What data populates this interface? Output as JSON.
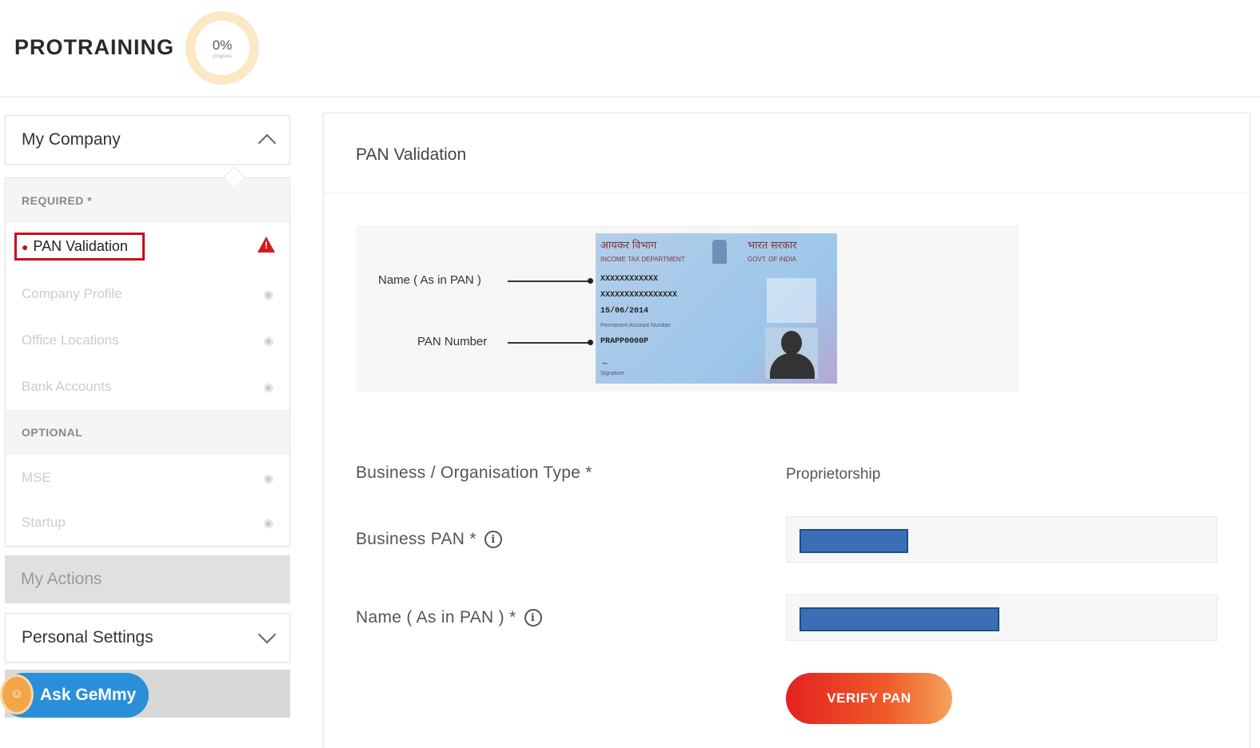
{
  "header": {
    "brand": "PROTRAINING",
    "progress_percent": "0%",
    "progress_caption": "progress",
    "progress_value": 0
  },
  "sidebar": {
    "my_company_label": "My Company",
    "required_label": "REQUIRED *",
    "optional_label": "OPTIONAL",
    "required_items": [
      {
        "label": "PAN Validation",
        "status": "alert"
      },
      {
        "label": "Company Profile",
        "status": "locked"
      },
      {
        "label": "Office Locations",
        "status": "locked"
      },
      {
        "label": "Bank Accounts",
        "status": "locked"
      }
    ],
    "optional_items": [
      {
        "label": "MSE",
        "status": "locked"
      },
      {
        "label": "Startup",
        "status": "locked"
      }
    ],
    "my_actions_label": "My Actions",
    "personal_settings_label": "Personal Settings",
    "ask_label": "Ask GeMmy"
  },
  "main": {
    "title": "PAN Validation",
    "illustration": {
      "name_label": "Name ( As in PAN )",
      "pan_label": "PAN Number",
      "card_header_left": "आयकर विभाग",
      "card_header_left_sub": "INCOME TAX DEPARTMENT",
      "card_header_right": "भारत सरकार",
      "card_header_right_sub": "GOVT. OF INDIA",
      "card_name": "XXXXXXXXXXXX",
      "card_father_name": "XXXXXXXXXXXXXXXX",
      "card_dob": "15/06/2014",
      "card_pan_caption": "Permanent Account Number",
      "card_pan": "PRAPP0000P",
      "card_signature_caption": "Signature"
    },
    "business_type_label": "Business / Organisation Type *",
    "business_type_value": "Proprietorship",
    "business_pan_label": "Business PAN *",
    "name_label": "Name ( As in PAN ) *",
    "verify_label": "VERIFY PAN"
  },
  "colors": {
    "alert_red": "#c4101d",
    "ask_blue": "#2a8fd8",
    "verify_gradient_start": "#e4211f",
    "verify_gradient_end": "#f6a25a"
  },
  "icons": {
    "collapse": "chevron-up-icon",
    "expand": "chevron-down-icon",
    "warning": "warning-icon",
    "locked": "eye-off-icon",
    "info": "info-icon"
  }
}
